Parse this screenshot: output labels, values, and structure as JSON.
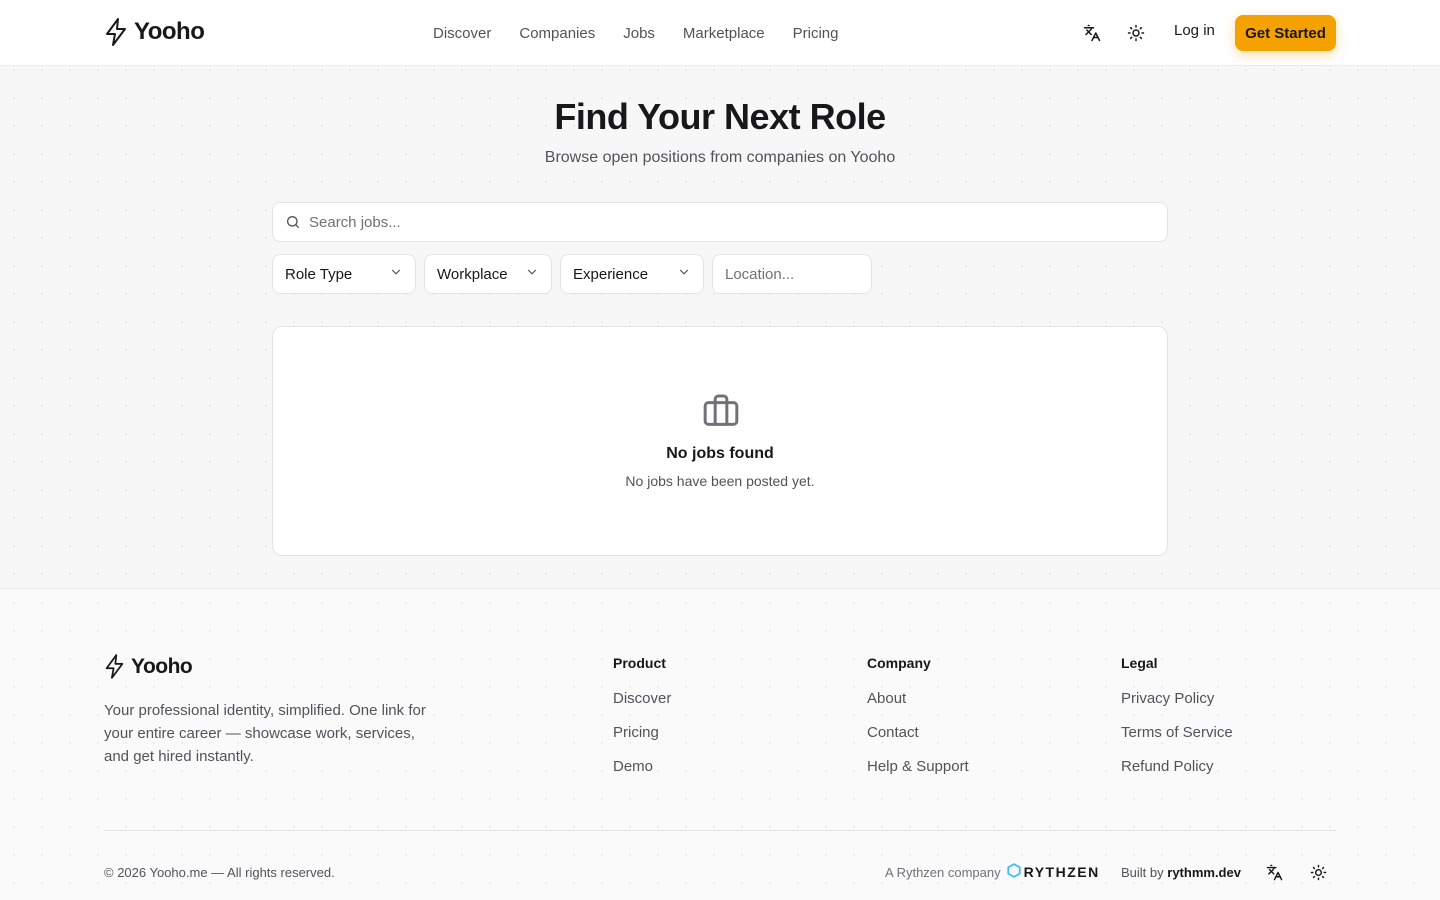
{
  "brand": {
    "name": "Yooho",
    "accent": "#f5a100"
  },
  "nav": {
    "items": [
      {
        "label": "Discover"
      },
      {
        "label": "Companies"
      },
      {
        "label": "Jobs"
      },
      {
        "label": "Marketplace"
      },
      {
        "label": "Pricing"
      }
    ],
    "language_icon": "translate-icon",
    "theme_icon": "sun-icon",
    "login_label": "Log in",
    "cta_label": "Get Started"
  },
  "main": {
    "title": "Find Your Next Role",
    "subtitle": "Browse open positions from companies on Yooho",
    "search": {
      "placeholder": "Search jobs..."
    },
    "filters": {
      "role_type": "Role Type",
      "workplace": "Workplace",
      "experience": "Experience",
      "location_placeholder": "Location..."
    },
    "empty_state": {
      "icon": "briefcase-icon",
      "title": "No jobs found",
      "message": "No jobs have been posted yet."
    }
  },
  "footer": {
    "tagline": "Your professional identity, simplified. One link for your entire career — showcase work, services, and get hired instantly.",
    "columns": [
      {
        "heading": "Product",
        "links": [
          "Discover",
          "Pricing",
          "Demo"
        ]
      },
      {
        "heading": "Company",
        "links": [
          "About",
          "Contact",
          "Help & Support"
        ]
      },
      {
        "heading": "Legal",
        "links": [
          "Privacy Policy",
          "Terms of Service",
          "Refund Policy"
        ]
      }
    ],
    "copyright": "© 2026 Yooho.me — All rights reserved.",
    "company_prefix": "A Rythzen company",
    "company_brand": "RYTHZEN",
    "built_by_prefix": "Built by",
    "built_by_name": "rythmm.dev"
  }
}
